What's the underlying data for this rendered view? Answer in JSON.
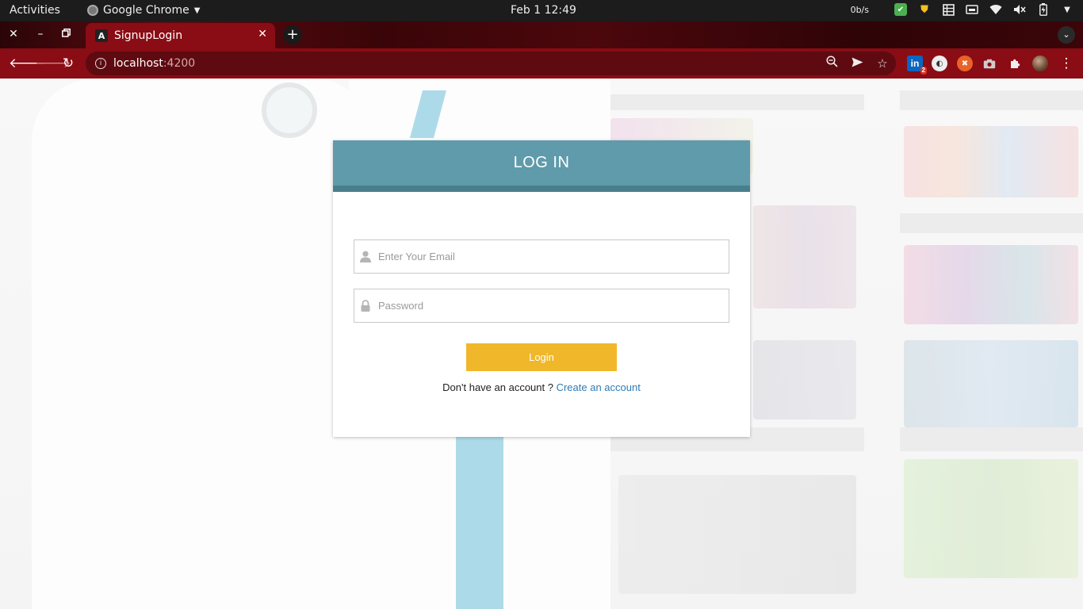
{
  "system_bar": {
    "activities": "Activities",
    "app_name": "Google Chrome",
    "clock": "Feb 1  12:49",
    "net_speed": "0b/s",
    "tray_icons": [
      "check-icon",
      "shield-icon",
      "table-icon",
      "storage-icon",
      "wifi-icon",
      "volume-mute-icon",
      "battery-icon",
      "system-menu-caret-icon"
    ]
  },
  "browser": {
    "tab": {
      "favicon": "A",
      "title": "SignupLogin"
    },
    "url": {
      "host": "localhost",
      "port": ":4200"
    },
    "extensions": {
      "linkedin_label": "in",
      "linkedin_badge": "2"
    }
  },
  "login_card": {
    "title": "LOG IN",
    "email_placeholder": "Enter Your Email",
    "password_placeholder": "Password",
    "login_button": "Login",
    "no_account_text": "Don't have an account ?",
    "create_account_link": "Create an account"
  },
  "colors": {
    "header": "#5f9baa",
    "header_border": "#497f8c",
    "button": "#f1b72a",
    "link": "#2f7bb5",
    "chrome_theme": "#8a0c14"
  }
}
